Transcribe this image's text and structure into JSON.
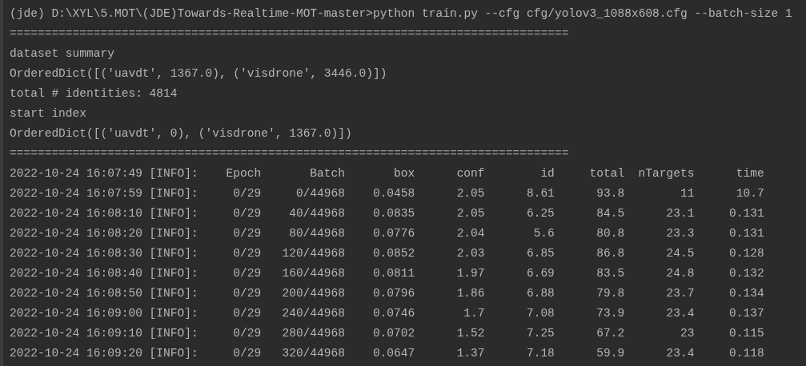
{
  "terminal": {
    "lines": [
      {
        "kind": "command",
        "text": "(jde) D:\\XYL\\5.MOT\\(JDE)Towards-Realtime-MOT-master>python train.py --cfg cfg/yolov3_1088x608.cfg --batch-size 1"
      },
      {
        "kind": "rule",
        "text": "================================================================================"
      },
      {
        "kind": "output",
        "text": "dataset summary"
      },
      {
        "kind": "output",
        "text": "OrderedDict([('uavdt', 1367.0), ('visdrone', 3446.0)])"
      },
      {
        "kind": "output",
        "text": "total # identities: 4814"
      },
      {
        "kind": "output",
        "text": "start index"
      },
      {
        "kind": "output",
        "text": "OrderedDict([('uavdt', 0), ('visdrone', 1367.0)])"
      },
      {
        "kind": "rule",
        "text": "================================================================================"
      }
    ],
    "log_table": {
      "header": {
        "timestamp": "2022-10-24 16:07:49 [INFO]:",
        "columns": [
          "Epoch",
          "Batch",
          "box",
          "conf",
          "id",
          "total",
          "nTargets",
          "time"
        ]
      },
      "rows": [
        {
          "timestamp": "2022-10-24 16:07:59 [INFO]:",
          "cells": [
            "0/29",
            "0/44968",
            "0.0458",
            "2.05",
            "8.61",
            "93.8",
            "11",
            "10.7"
          ]
        },
        {
          "timestamp": "2022-10-24 16:08:10 [INFO]:",
          "cells": [
            "0/29",
            "40/44968",
            "0.0835",
            "2.05",
            "6.25",
            "84.5",
            "23.1",
            "0.131"
          ]
        },
        {
          "timestamp": "2022-10-24 16:08:20 [INFO]:",
          "cells": [
            "0/29",
            "80/44968",
            "0.0776",
            "2.04",
            "5.6",
            "80.8",
            "23.3",
            "0.131"
          ]
        },
        {
          "timestamp": "2022-10-24 16:08:30 [INFO]:",
          "cells": [
            "0/29",
            "120/44968",
            "0.0852",
            "2.03",
            "6.85",
            "86.8",
            "24.5",
            "0.128"
          ]
        },
        {
          "timestamp": "2022-10-24 16:08:40 [INFO]:",
          "cells": [
            "0/29",
            "160/44968",
            "0.0811",
            "1.97",
            "6.69",
            "83.5",
            "24.8",
            "0.132"
          ]
        },
        {
          "timestamp": "2022-10-24 16:08:50 [INFO]:",
          "cells": [
            "0/29",
            "200/44968",
            "0.0796",
            "1.86",
            "6.88",
            "79.8",
            "23.7",
            "0.134"
          ]
        },
        {
          "timestamp": "2022-10-24 16:09:00 [INFO]:",
          "cells": [
            "0/29",
            "240/44968",
            "0.0746",
            "1.7",
            "7.08",
            "73.9",
            "23.4",
            "0.137"
          ]
        },
        {
          "timestamp": "2022-10-24 16:09:10 [INFO]:",
          "cells": [
            "0/29",
            "280/44968",
            "0.0702",
            "1.52",
            "7.25",
            "67.2",
            "23",
            "0.115"
          ]
        },
        {
          "timestamp": "2022-10-24 16:09:20 [INFO]:",
          "cells": [
            "0/29",
            "320/44968",
            "0.0647",
            "1.37",
            "7.18",
            "59.9",
            "23.4",
            "0.118"
          ]
        }
      ]
    }
  }
}
